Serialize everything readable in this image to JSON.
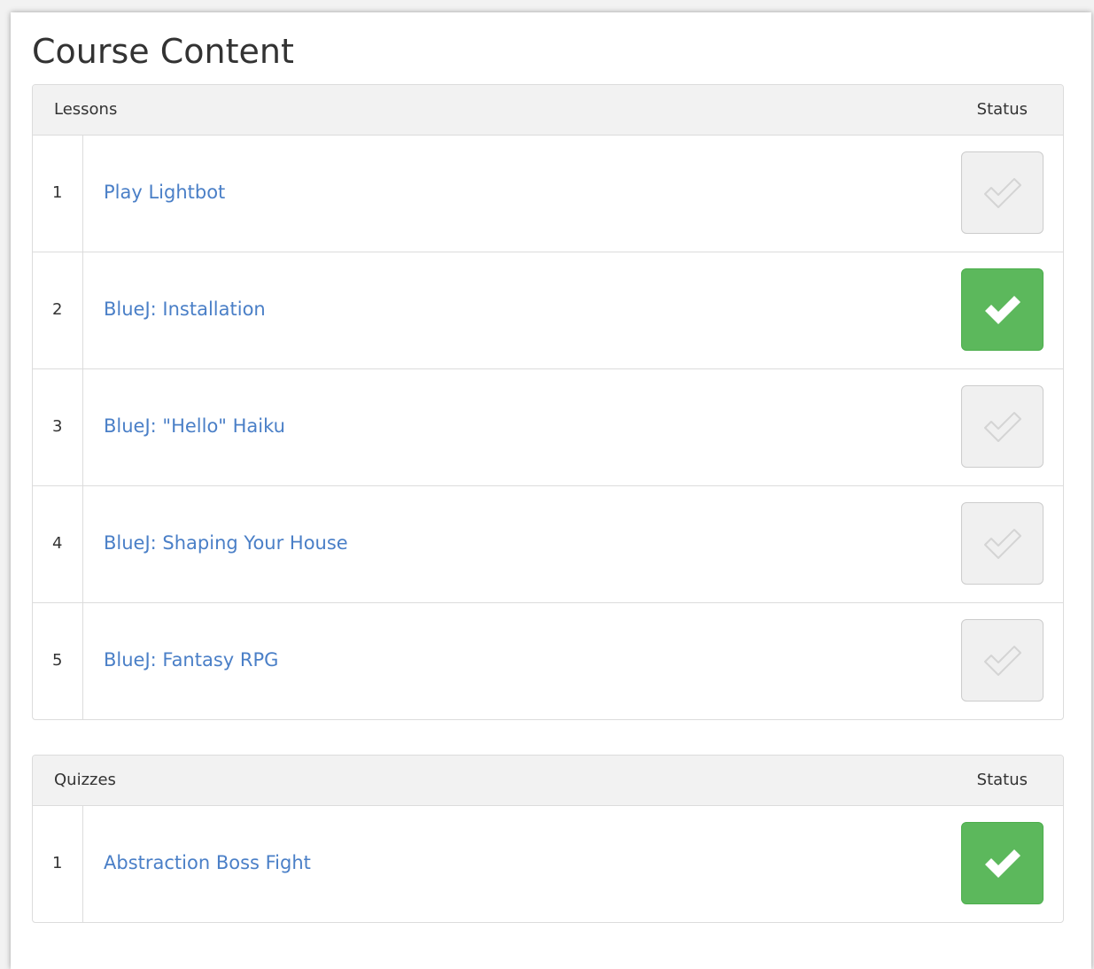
{
  "page": {
    "title": "Course Content"
  },
  "lessons": {
    "header_label": "Lessons",
    "status_label": "Status",
    "items": [
      {
        "number": "1",
        "title": "Play Lightbot",
        "completed": false
      },
      {
        "number": "2",
        "title": "BlueJ: Installation",
        "completed": true
      },
      {
        "number": "3",
        "title": "BlueJ: \"Hello\" Haiku",
        "completed": false
      },
      {
        "number": "4",
        "title": "BlueJ: Shaping Your House",
        "completed": false
      },
      {
        "number": "5",
        "title": "BlueJ: Fantasy RPG",
        "completed": false
      }
    ]
  },
  "quizzes": {
    "header_label": "Quizzes",
    "status_label": "Status",
    "items": [
      {
        "number": "1",
        "title": "Abstraction Boss Fight",
        "completed": true
      }
    ]
  },
  "colors": {
    "link": "#4a7fc7",
    "completed": "#5cb85c",
    "pending": "#f0f0f0"
  },
  "icons": {
    "completed": "check-icon",
    "pending": "check-outline-icon"
  }
}
